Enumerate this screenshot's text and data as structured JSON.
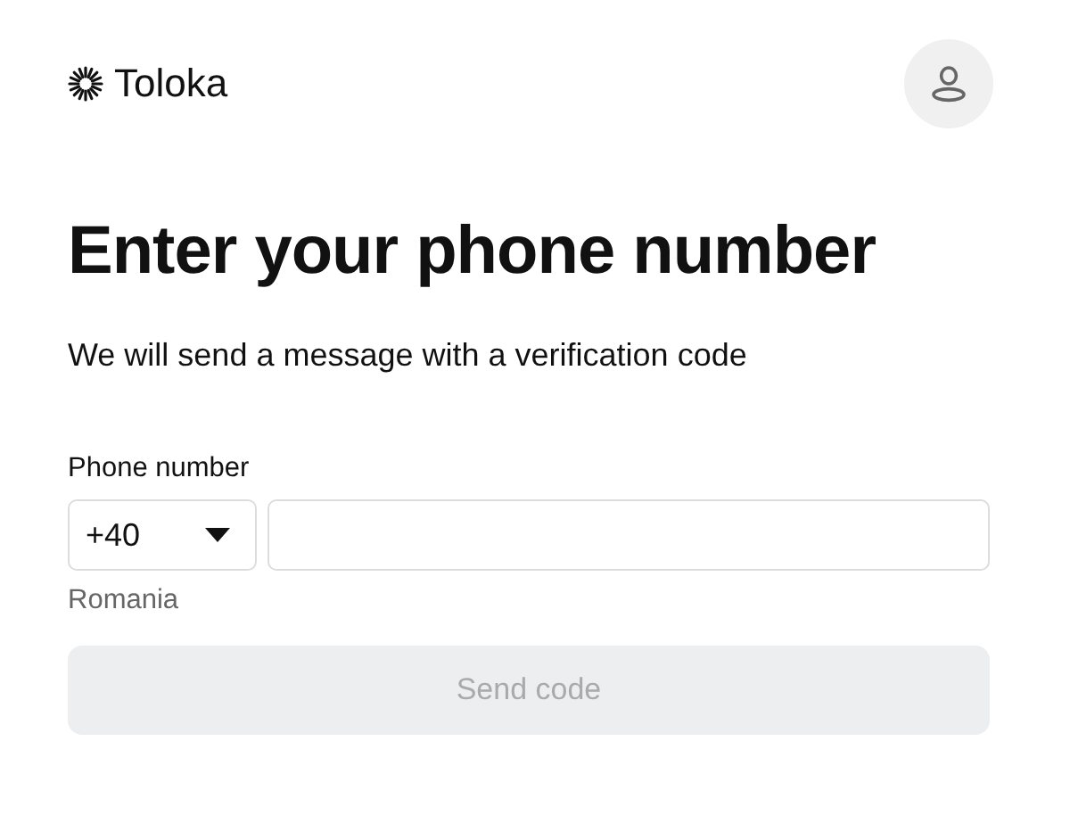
{
  "header": {
    "brand": "Toloka"
  },
  "title": "Enter your phone number",
  "subtitle": "We will send a message with a verification code",
  "phone": {
    "label": "Phone number",
    "country_code": "+40",
    "country": "Romania"
  },
  "submit": {
    "label": "Send code",
    "disabled": true
  }
}
